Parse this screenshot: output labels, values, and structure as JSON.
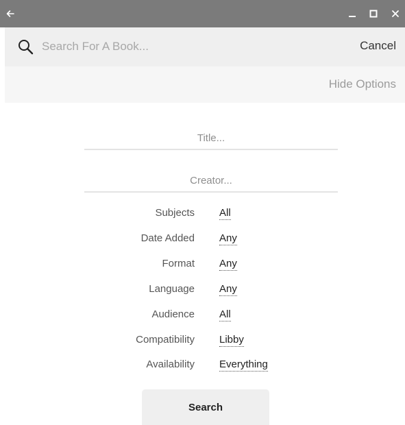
{
  "titlebar": {
    "icons": {
      "back": "arrow-left-icon",
      "minimize": "minimize-icon",
      "maximize": "maximize-icon",
      "close": "close-icon"
    }
  },
  "search": {
    "placeholder": "Search For A Book...",
    "value": "",
    "cancel_label": "Cancel",
    "icon": "search-icon"
  },
  "options": {
    "hide_label": "Hide Options"
  },
  "fields": {
    "title_placeholder": "Title...",
    "creator_placeholder": "Creator..."
  },
  "filters": [
    {
      "label": "Subjects",
      "value": "All"
    },
    {
      "label": "Date Added",
      "value": "Any"
    },
    {
      "label": "Format",
      "value": "Any"
    },
    {
      "label": "Language",
      "value": "Any"
    },
    {
      "label": "Audience",
      "value": "All"
    },
    {
      "label": "Compatibility",
      "value": "Libby"
    },
    {
      "label": "Availability",
      "value": "Everything"
    }
  ],
  "search_button": {
    "label": "Search"
  },
  "colors": {
    "titlebar": "#7b7b7b",
    "searchbar": "#efefef",
    "optionsbar": "#f6f6f6"
  }
}
